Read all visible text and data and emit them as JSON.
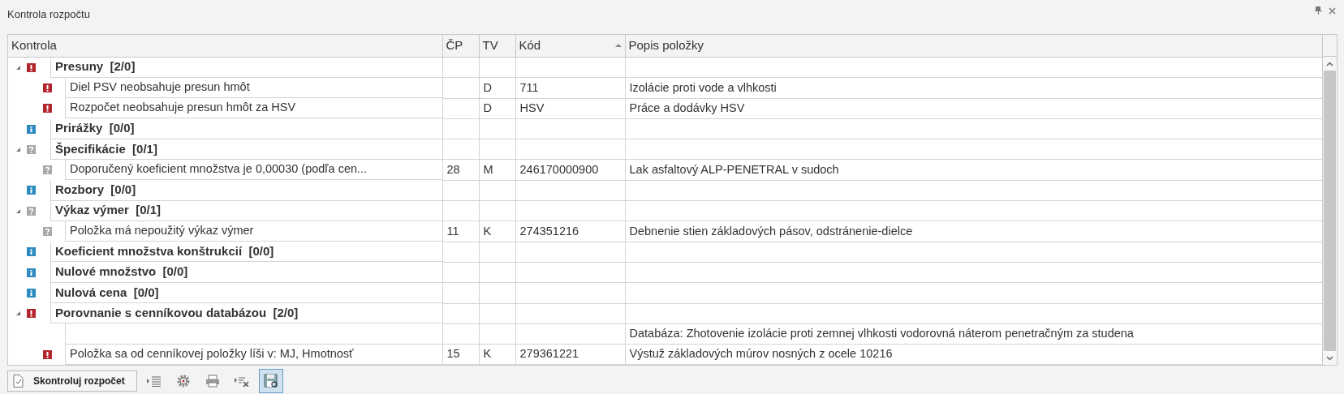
{
  "window": {
    "title": "Kontrola rozpočtu"
  },
  "columns": [
    {
      "label": "Kontrola"
    },
    {
      "label": "ČP"
    },
    {
      "label": "TV"
    },
    {
      "label": "Kód",
      "sort_ascending": true
    },
    {
      "label": "Popis položky"
    }
  ],
  "groups": [
    {
      "kind": "error",
      "title": "Presuny  [2/0]",
      "expanded": true,
      "children": [
        {
          "kind": "error",
          "text": "Diel PSV neobsahuje presun hmôt",
          "tv": "D",
          "kod": "711",
          "popis": "Izolácie proti vode a vlhkosti"
        },
        {
          "kind": "error",
          "text": "Rozpočet neobsahuje presun hmôt za HSV",
          "tv": "D",
          "kod": "HSV",
          "popis": "Práce a dodávky HSV"
        }
      ]
    },
    {
      "kind": "info",
      "title": "Prirážky  [0/0]"
    },
    {
      "kind": "question",
      "title": "Špecifikácie  [0/1]",
      "expanded": true,
      "children": [
        {
          "kind": "question",
          "text": "Doporučený koeficient množstva je 0,00030 (podľa cen...",
          "cp": "28",
          "tv": "M",
          "kod": "246170000900",
          "popis": "Lak asfaltový ALP-PENETRAL v sudoch"
        }
      ]
    },
    {
      "kind": "info",
      "title": "Rozbory  [0/0]"
    },
    {
      "kind": "question",
      "title": "Výkaz výmer  [0/1]",
      "expanded": true,
      "children": [
        {
          "kind": "question",
          "text": "Položka má nepoužitý výkaz výmer",
          "cp": "11",
          "tv": "K",
          "kod": "274351216",
          "popis": "Debnenie stien základových pásov, odstránenie-dielce"
        }
      ]
    },
    {
      "kind": "info",
      "title": "Koeficient množstva konštrukcií  [0/0]"
    },
    {
      "kind": "info",
      "title": "Nulové množstvo  [0/0]"
    },
    {
      "kind": "info",
      "title": "Nulová cena  [0/0]"
    },
    {
      "kind": "error",
      "title": "Porovnanie s cenníkovou databázou  [2/0]",
      "expanded": true,
      "children": [
        {
          "kind": "note",
          "popis": "Databáza: Zhotovenie izolácie proti zemnej vlhkosti vodorovná náterom penetračným za studena"
        },
        {
          "kind": "error",
          "text": "Položka sa od cenníkovej položky líši v: MJ, Hmotnosť",
          "cp": "15",
          "tv": "K",
          "kod": "279361221",
          "popis": "Výstuž základových múrov nosných z ocele 10216"
        }
      ]
    }
  ],
  "toolbar": {
    "button": "Skontroluj rozpočet",
    "tools": [
      {
        "kind": "list",
        "selected": false
      },
      {
        "kind": "gear",
        "selected": false
      },
      {
        "kind": "printer",
        "selected": false
      },
      {
        "kind": "remove",
        "selected": false
      },
      {
        "kind": "save",
        "selected": true
      }
    ]
  }
}
